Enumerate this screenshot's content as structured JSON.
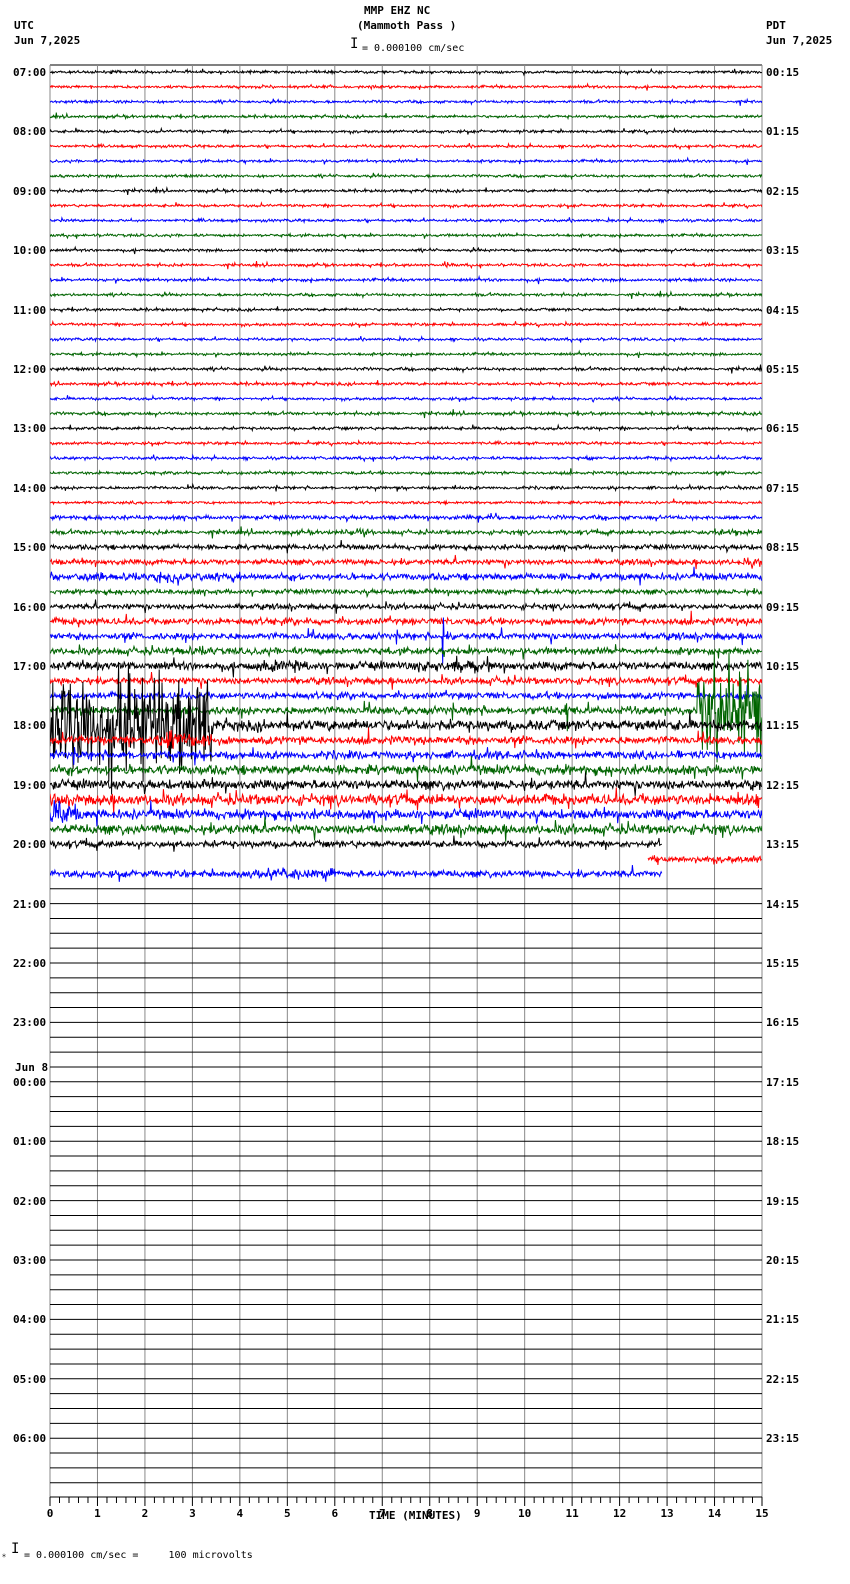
{
  "header": {
    "title": "MMP EHZ NC",
    "subtitle": "(Mammoth Pass )",
    "left_tz": "UTC",
    "left_date": "Jun 7,2025",
    "right_tz": "PDT",
    "right_date": "Jun 7,2025",
    "scale": "= 0.000100 cm/sec"
  },
  "footer": {
    "scale": "= 0.000100 cm/sec =     100 microvolts"
  },
  "chart_data": {
    "type": "line",
    "title": "MMP EHZ NC (Mammoth Pass )",
    "xlabel": "TIME (MINUTES)",
    "xlim": [
      0,
      15
    ],
    "x_ticks": [
      "0",
      "1",
      "2",
      "3",
      "4",
      "5",
      "6",
      "7",
      "8",
      "9",
      "10",
      "11",
      "12",
      "13",
      "14",
      "15"
    ],
    "left_labels": [
      "07:00",
      "08:00",
      "09:00",
      "10:00",
      "11:00",
      "12:00",
      "13:00",
      "14:00",
      "15:00",
      "16:00",
      "17:00",
      "18:00",
      "19:00",
      "20:00",
      "21:00",
      "22:00",
      "23:00",
      "00:00",
      "01:00",
      "02:00",
      "03:00",
      "04:00",
      "05:00",
      "06:00"
    ],
    "date_change_label": "Jun 8",
    "right_labels": [
      "00:15",
      "01:15",
      "02:15",
      "03:15",
      "04:15",
      "05:15",
      "06:15",
      "07:15",
      "08:15",
      "09:15",
      "10:15",
      "11:15",
      "12:15",
      "13:15",
      "14:15",
      "15:15",
      "16:15",
      "17:15",
      "18:15",
      "19:15",
      "20:15",
      "21:15",
      "22:15",
      "23:15"
    ],
    "trace_colors": [
      "#000000",
      "#ff0000",
      "#0000ff",
      "#006400"
    ],
    "rows_per_hour": 4,
    "total_rows": 96,
    "noise_levels": [
      1,
      1,
      1,
      1,
      1,
      1,
      1,
      1,
      1,
      1,
      1,
      1,
      1,
      1,
      1.1,
      1,
      1,
      1,
      1,
      1,
      1.1,
      1.1,
      1,
      1.1,
      1.1,
      1,
      1.1,
      1.1,
      1.1,
      1,
      1.5,
      1.5,
      1.8,
      2,
      2.5,
      1.8,
      2,
      2.5,
      2.5,
      2.5,
      3,
      2.5,
      2.5,
      3,
      4,
      3,
      3,
      3.5,
      3.5,
      4,
      3.5,
      3.5,
      2.5,
      2.5,
      2.5
    ],
    "partial_rows": [
      {
        "row": 52,
        "start": 0,
        "end": 12.9
      },
      {
        "row": 53,
        "start": 12.6,
        "end": 15
      },
      {
        "row": 54,
        "start": 0,
        "end": 12.9
      }
    ],
    "events": [
      {
        "row": 13,
        "start": 8.3,
        "end": 8.5,
        "amp": 3
      },
      {
        "row": 22,
        "start": 11.4,
        "end": 11.5,
        "amp": 4
      },
      {
        "row": 26,
        "start": 11.35,
        "end": 11.45,
        "amp": 4
      },
      {
        "row": 30,
        "start": 9.0,
        "end": 9.4,
        "amp": 4
      },
      {
        "row": 31,
        "start": 6.1,
        "end": 6.7,
        "amp": 3
      },
      {
        "row": 31,
        "start": 13.8,
        "end": 15,
        "amp": 3
      },
      {
        "row": 33,
        "start": 14.5,
        "end": 15,
        "amp": 4
      },
      {
        "row": 34,
        "start": 0,
        "end": 4.0,
        "amp": 4
      },
      {
        "row": 38,
        "start": 8.26,
        "end": 8.3,
        "amp": 70
      },
      {
        "row": 39,
        "start": 2.6,
        "end": 3.5,
        "amp": 5
      },
      {
        "row": 40,
        "start": 4.3,
        "end": 5.5,
        "amp": 6
      },
      {
        "row": 40,
        "start": 7.7,
        "end": 9.3,
        "amp": 7
      },
      {
        "row": 43,
        "start": 10.55,
        "end": 10.6,
        "amp": 25
      },
      {
        "row": 43,
        "start": 10.85,
        "end": 10.9,
        "amp": 30
      },
      {
        "row": 43,
        "start": 13.6,
        "end": 15,
        "amp": 45
      },
      {
        "row": 44,
        "start": 0,
        "end": 3.4,
        "amp": 45
      },
      {
        "row": 45,
        "start": 2.2,
        "end": 3.4,
        "amp": 8
      },
      {
        "row": 49,
        "start": 14.4,
        "end": 15,
        "amp": 7
      },
      {
        "row": 50,
        "start": 0,
        "end": 0.6,
        "amp": 14
      },
      {
        "row": 52,
        "start": 2.6,
        "end": 2.7,
        "amp": 6
      },
      {
        "row": 54,
        "start": 4.0,
        "end": 6.0,
        "amp": 5
      }
    ]
  }
}
